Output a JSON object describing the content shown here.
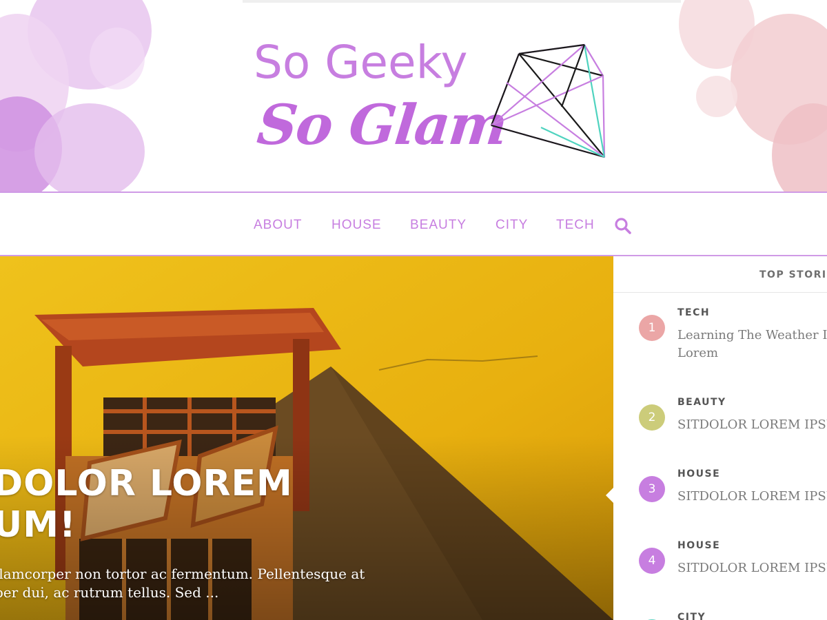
{
  "site": {
    "brand_line1": "So Geeky",
    "brand_line2": "So Glam",
    "accent_color": "#c77ee0",
    "border_color": "#cf9ae6"
  },
  "nav": {
    "items": [
      {
        "label": "ABOUT"
      },
      {
        "label": "HOUSE"
      },
      {
        "label": "BEAUTY"
      },
      {
        "label": "CITY"
      },
      {
        "label": "TECH"
      }
    ],
    "search_icon": "search-icon"
  },
  "hero": {
    "title_line1": "DOLOR LOREM",
    "title_line2": "UM!",
    "excerpt_line1": "llamcorper non tortor ac fermentum. Pellentesque at",
    "excerpt_line2": "per dui, ac rutrum tellus. Sed ..."
  },
  "sidebar": {
    "title": "TOP STORIE",
    "stories": [
      {
        "number": "1",
        "category": "TECH",
        "title": "Learning The Weather Ins Lorem",
        "badge_color": "#eba6a6"
      },
      {
        "number": "2",
        "category": "BEAUTY",
        "title": "SITDOLOR LOREM IPSUM",
        "badge_color": "#cccc7a"
      },
      {
        "number": "3",
        "category": "HOUSE",
        "title": "SITDOLOR LOREM IPSUM",
        "badge_color": "#c77ee0"
      },
      {
        "number": "4",
        "category": "HOUSE",
        "title": "SITDOLOR LOREM IPSUM",
        "badge_color": "#c77ee0"
      },
      {
        "number": "",
        "category": "CITY",
        "title": "",
        "badge_color": "#5fd3c2"
      }
    ]
  }
}
